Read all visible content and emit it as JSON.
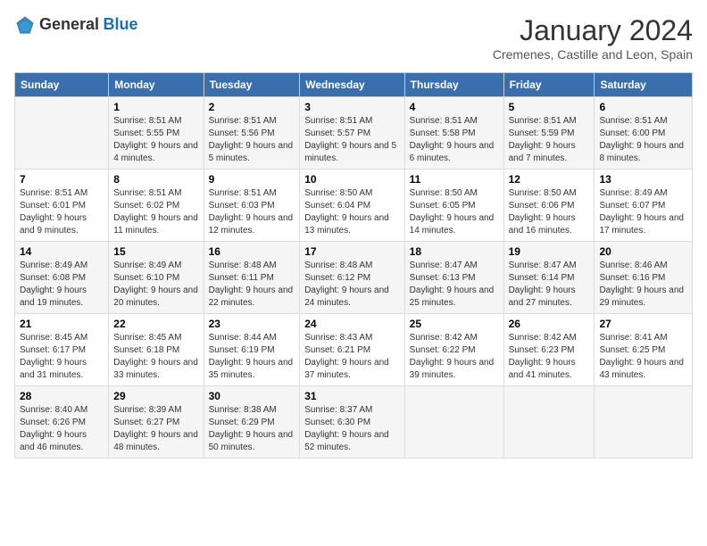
{
  "logo": {
    "text_general": "General",
    "text_blue": "Blue"
  },
  "header": {
    "title": "January 2024",
    "subtitle": "Cremenes, Castille and Leon, Spain"
  },
  "weekdays": [
    "Sunday",
    "Monday",
    "Tuesday",
    "Wednesday",
    "Thursday",
    "Friday",
    "Saturday"
  ],
  "weeks": [
    [
      {
        "day": "",
        "sunrise": "",
        "sunset": "",
        "daylight": ""
      },
      {
        "day": "1",
        "sunrise": "Sunrise: 8:51 AM",
        "sunset": "Sunset: 5:55 PM",
        "daylight": "Daylight: 9 hours and 4 minutes."
      },
      {
        "day": "2",
        "sunrise": "Sunrise: 8:51 AM",
        "sunset": "Sunset: 5:56 PM",
        "daylight": "Daylight: 9 hours and 5 minutes."
      },
      {
        "day": "3",
        "sunrise": "Sunrise: 8:51 AM",
        "sunset": "Sunset: 5:57 PM",
        "daylight": "Daylight: 9 hours and 5 minutes."
      },
      {
        "day": "4",
        "sunrise": "Sunrise: 8:51 AM",
        "sunset": "Sunset: 5:58 PM",
        "daylight": "Daylight: 9 hours and 6 minutes."
      },
      {
        "day": "5",
        "sunrise": "Sunrise: 8:51 AM",
        "sunset": "Sunset: 5:59 PM",
        "daylight": "Daylight: 9 hours and 7 minutes."
      },
      {
        "day": "6",
        "sunrise": "Sunrise: 8:51 AM",
        "sunset": "Sunset: 6:00 PM",
        "daylight": "Daylight: 9 hours and 8 minutes."
      }
    ],
    [
      {
        "day": "7",
        "sunrise": "Sunrise: 8:51 AM",
        "sunset": "Sunset: 6:01 PM",
        "daylight": "Daylight: 9 hours and 9 minutes."
      },
      {
        "day": "8",
        "sunrise": "Sunrise: 8:51 AM",
        "sunset": "Sunset: 6:02 PM",
        "daylight": "Daylight: 9 hours and 11 minutes."
      },
      {
        "day": "9",
        "sunrise": "Sunrise: 8:51 AM",
        "sunset": "Sunset: 6:03 PM",
        "daylight": "Daylight: 9 hours and 12 minutes."
      },
      {
        "day": "10",
        "sunrise": "Sunrise: 8:50 AM",
        "sunset": "Sunset: 6:04 PM",
        "daylight": "Daylight: 9 hours and 13 minutes."
      },
      {
        "day": "11",
        "sunrise": "Sunrise: 8:50 AM",
        "sunset": "Sunset: 6:05 PM",
        "daylight": "Daylight: 9 hours and 14 minutes."
      },
      {
        "day": "12",
        "sunrise": "Sunrise: 8:50 AM",
        "sunset": "Sunset: 6:06 PM",
        "daylight": "Daylight: 9 hours and 16 minutes."
      },
      {
        "day": "13",
        "sunrise": "Sunrise: 8:49 AM",
        "sunset": "Sunset: 6:07 PM",
        "daylight": "Daylight: 9 hours and 17 minutes."
      }
    ],
    [
      {
        "day": "14",
        "sunrise": "Sunrise: 8:49 AM",
        "sunset": "Sunset: 6:08 PM",
        "daylight": "Daylight: 9 hours and 19 minutes."
      },
      {
        "day": "15",
        "sunrise": "Sunrise: 8:49 AM",
        "sunset": "Sunset: 6:10 PM",
        "daylight": "Daylight: 9 hours and 20 minutes."
      },
      {
        "day": "16",
        "sunrise": "Sunrise: 8:48 AM",
        "sunset": "Sunset: 6:11 PM",
        "daylight": "Daylight: 9 hours and 22 minutes."
      },
      {
        "day": "17",
        "sunrise": "Sunrise: 8:48 AM",
        "sunset": "Sunset: 6:12 PM",
        "daylight": "Daylight: 9 hours and 24 minutes."
      },
      {
        "day": "18",
        "sunrise": "Sunrise: 8:47 AM",
        "sunset": "Sunset: 6:13 PM",
        "daylight": "Daylight: 9 hours and 25 minutes."
      },
      {
        "day": "19",
        "sunrise": "Sunrise: 8:47 AM",
        "sunset": "Sunset: 6:14 PM",
        "daylight": "Daylight: 9 hours and 27 minutes."
      },
      {
        "day": "20",
        "sunrise": "Sunrise: 8:46 AM",
        "sunset": "Sunset: 6:16 PM",
        "daylight": "Daylight: 9 hours and 29 minutes."
      }
    ],
    [
      {
        "day": "21",
        "sunrise": "Sunrise: 8:45 AM",
        "sunset": "Sunset: 6:17 PM",
        "daylight": "Daylight: 9 hours and 31 minutes."
      },
      {
        "day": "22",
        "sunrise": "Sunrise: 8:45 AM",
        "sunset": "Sunset: 6:18 PM",
        "daylight": "Daylight: 9 hours and 33 minutes."
      },
      {
        "day": "23",
        "sunrise": "Sunrise: 8:44 AM",
        "sunset": "Sunset: 6:19 PM",
        "daylight": "Daylight: 9 hours and 35 minutes."
      },
      {
        "day": "24",
        "sunrise": "Sunrise: 8:43 AM",
        "sunset": "Sunset: 6:21 PM",
        "daylight": "Daylight: 9 hours and 37 minutes."
      },
      {
        "day": "25",
        "sunrise": "Sunrise: 8:42 AM",
        "sunset": "Sunset: 6:22 PM",
        "daylight": "Daylight: 9 hours and 39 minutes."
      },
      {
        "day": "26",
        "sunrise": "Sunrise: 8:42 AM",
        "sunset": "Sunset: 6:23 PM",
        "daylight": "Daylight: 9 hours and 41 minutes."
      },
      {
        "day": "27",
        "sunrise": "Sunrise: 8:41 AM",
        "sunset": "Sunset: 6:25 PM",
        "daylight": "Daylight: 9 hours and 43 minutes."
      }
    ],
    [
      {
        "day": "28",
        "sunrise": "Sunrise: 8:40 AM",
        "sunset": "Sunset: 6:26 PM",
        "daylight": "Daylight: 9 hours and 46 minutes."
      },
      {
        "day": "29",
        "sunrise": "Sunrise: 8:39 AM",
        "sunset": "Sunset: 6:27 PM",
        "daylight": "Daylight: 9 hours and 48 minutes."
      },
      {
        "day": "30",
        "sunrise": "Sunrise: 8:38 AM",
        "sunset": "Sunset: 6:29 PM",
        "daylight": "Daylight: 9 hours and 50 minutes."
      },
      {
        "day": "31",
        "sunrise": "Sunrise: 8:37 AM",
        "sunset": "Sunset: 6:30 PM",
        "daylight": "Daylight: 9 hours and 52 minutes."
      },
      {
        "day": "",
        "sunrise": "",
        "sunset": "",
        "daylight": ""
      },
      {
        "day": "",
        "sunrise": "",
        "sunset": "",
        "daylight": ""
      },
      {
        "day": "",
        "sunrise": "",
        "sunset": "",
        "daylight": ""
      }
    ]
  ]
}
